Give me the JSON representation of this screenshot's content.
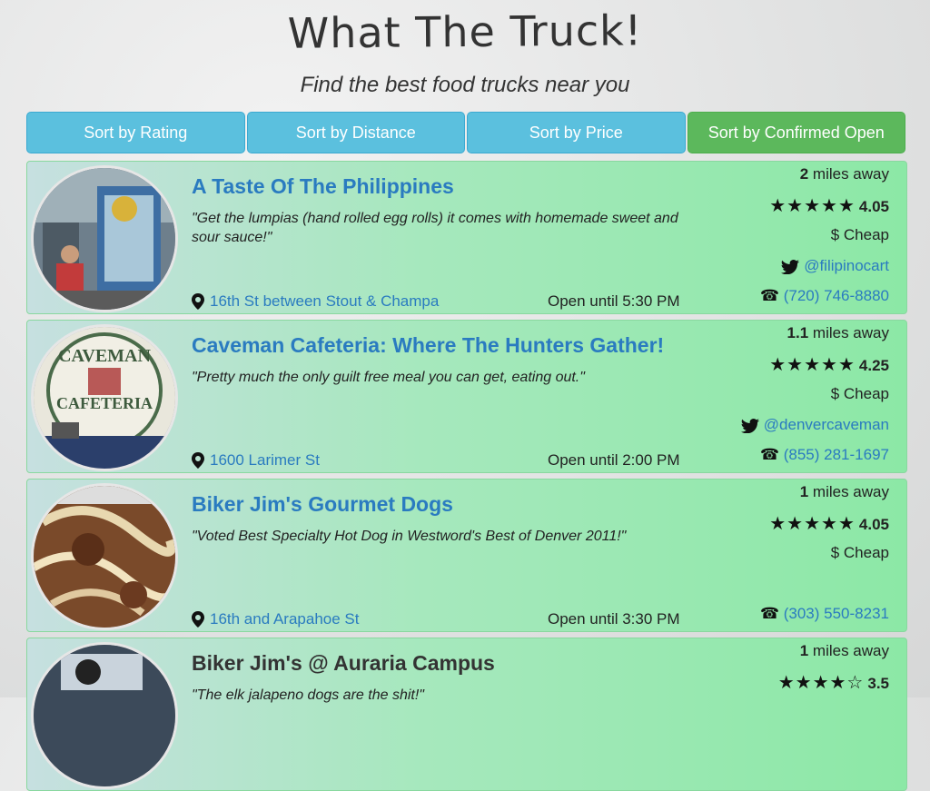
{
  "header": {
    "title": "What The Truck!",
    "subtitle": "Find the best food trucks near you"
  },
  "sort_buttons": [
    {
      "label": "Sort by Rating",
      "active": false
    },
    {
      "label": "Sort by Distance",
      "active": false
    },
    {
      "label": "Sort by Price",
      "active": false
    },
    {
      "label": "Sort by Confirmed Open",
      "active": true
    }
  ],
  "colors": {
    "sort_blue": "#5bc0de",
    "sort_green": "#5cb85c",
    "link": "#2a7bc0"
  },
  "trucks": [
    {
      "name": "A Taste Of The Philippines",
      "quote": "\"Get the lumpias (hand rolled egg rolls) it comes with homemade sweet and sour sauce!\"",
      "distance_value": "2",
      "distance_unit": "miles away",
      "stars": "★★★★★",
      "rating": "4.05",
      "price": "$ Cheap",
      "twitter": "@filipinocart",
      "phone": "(720) 746-8880",
      "address": "16th St between Stout & Champa",
      "hours": "Open until 5:30 PM"
    },
    {
      "name": "Caveman Cafeteria: Where The Hunters Gather!",
      "quote": "\"Pretty much the only guilt free meal you can get, eating out.\"",
      "distance_value": "1.1",
      "distance_unit": "miles away",
      "stars": "★★★★★",
      "rating": "4.25",
      "price": "$ Cheap",
      "twitter": "@denvercaveman",
      "phone": "(855) 281-1697",
      "address": "1600 Larimer St",
      "hours": "Open until 2:00 PM"
    },
    {
      "name": "Biker Jim's Gourmet Dogs",
      "quote": "\"Voted Best Specialty Hot Dog in Westword's Best of Denver 2011!\"",
      "distance_value": "1",
      "distance_unit": "miles away",
      "stars": "★★★★★",
      "rating": "4.05",
      "price": "$ Cheap",
      "phone": "(303) 550-8231",
      "address": "16th and Arapahoe St",
      "hours": "Open until 3:30 PM"
    },
    {
      "name": "Biker Jim's @ Auraria Campus",
      "quote": "\"The elk jalapeno dogs are the shit!\"",
      "distance_value": "1",
      "distance_unit": "miles away",
      "stars": "★★★★☆",
      "rating": "3.5"
    }
  ]
}
